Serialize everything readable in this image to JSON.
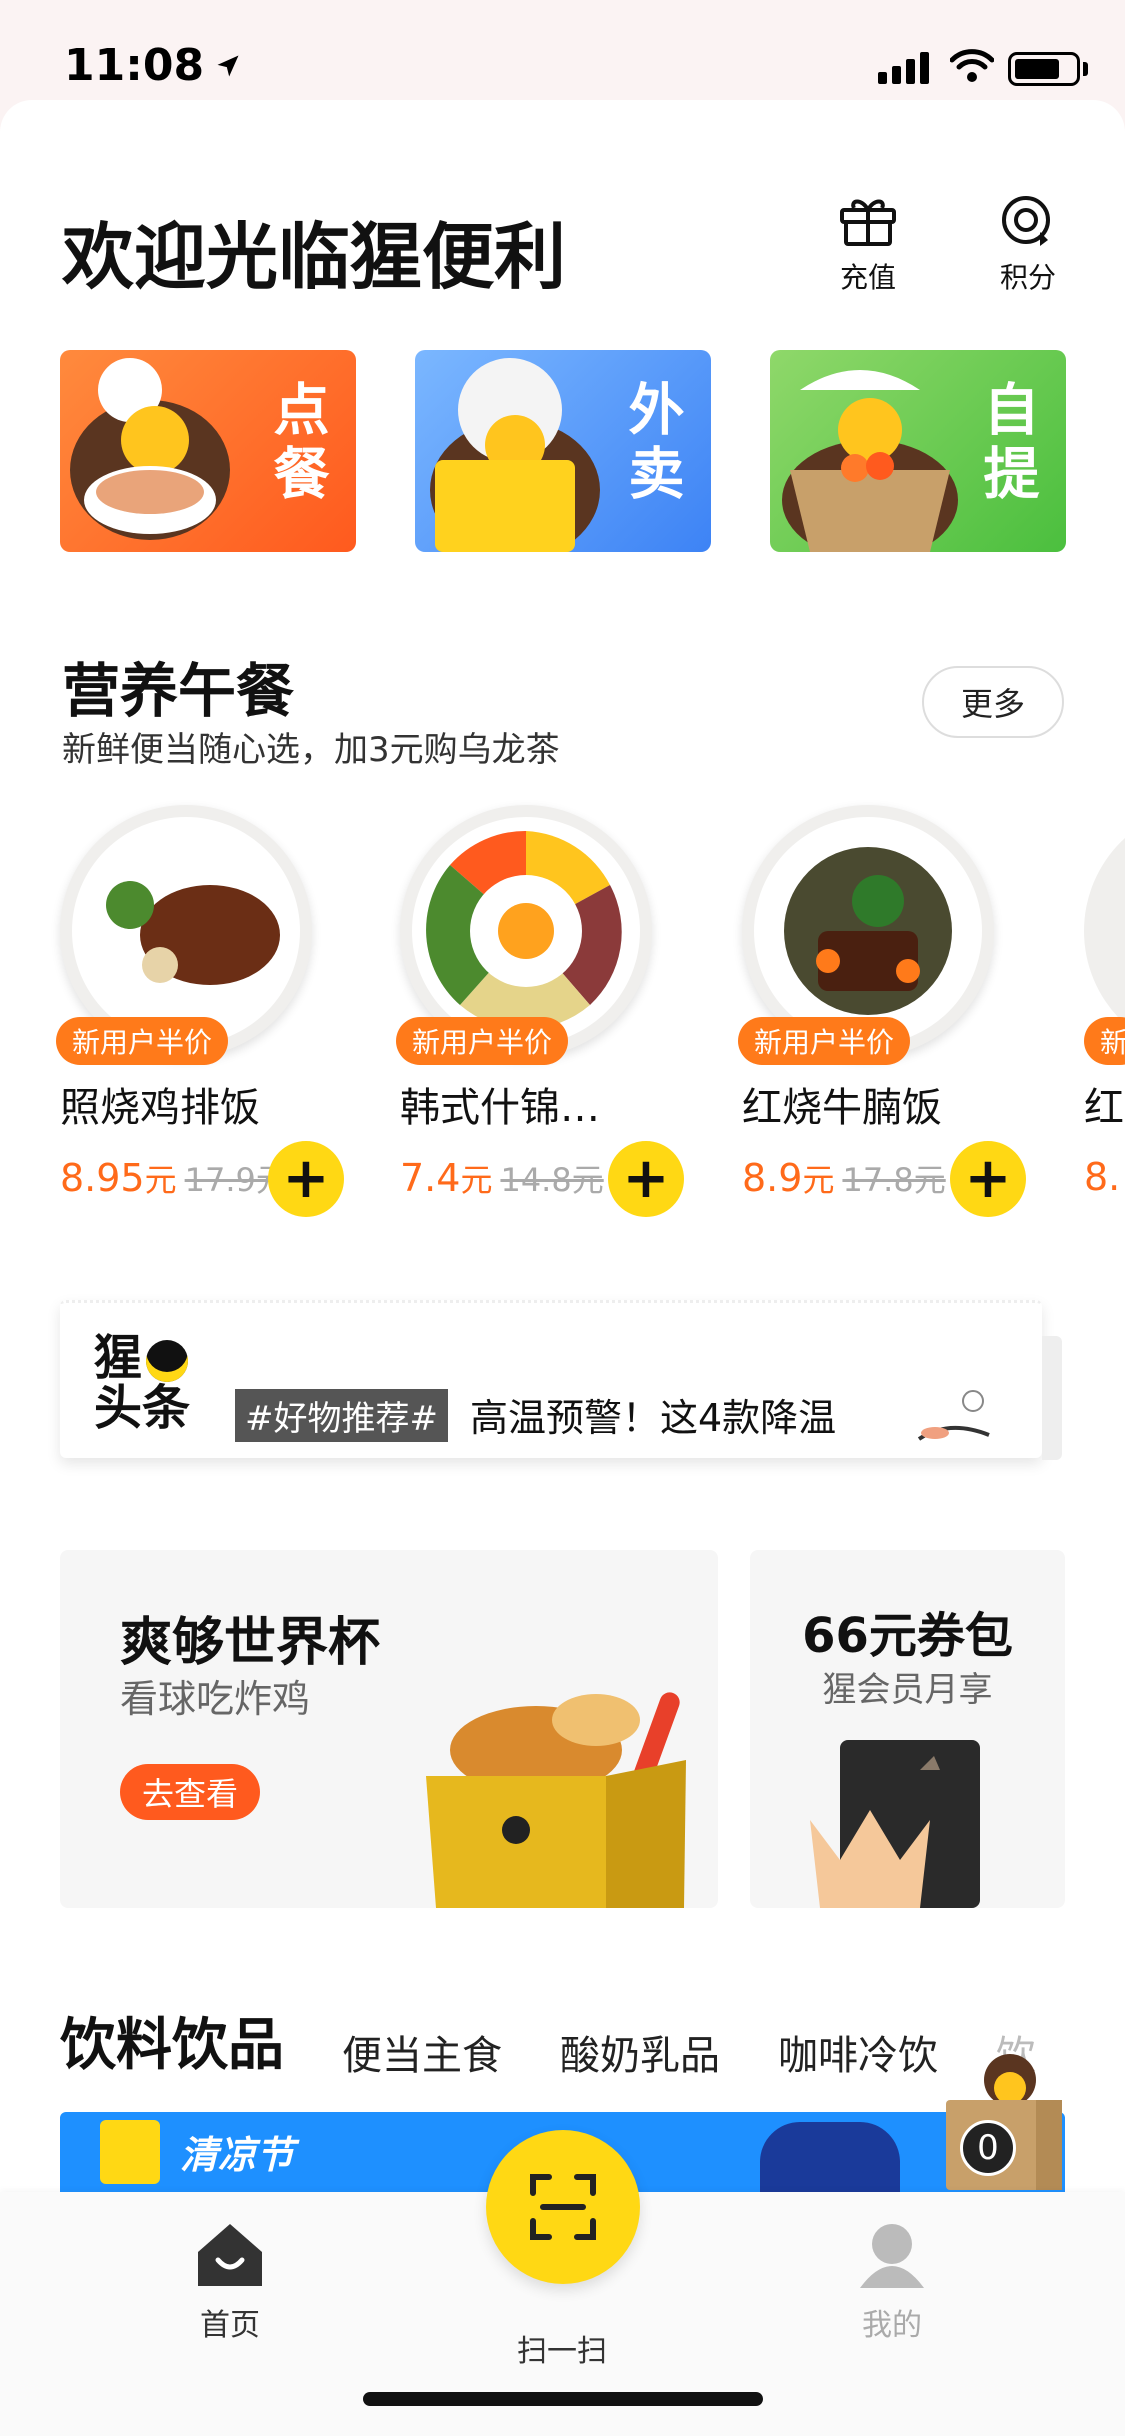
{
  "status_bar": {
    "time": "11:08"
  },
  "header": {
    "welcome": "欢迎光临猩便利",
    "actions": [
      {
        "label": "充值",
        "icon": "gift-icon"
      },
      {
        "label": "积分",
        "icon": "points-icon"
      }
    ]
  },
  "services": [
    {
      "label": "点餐",
      "color": "#ff6a1e"
    },
    {
      "label": "外卖",
      "color": "#4a8ef7"
    },
    {
      "label": "自提",
      "color": "#5bc447"
    }
  ],
  "lunch": {
    "title": "营养午餐",
    "subtitle": "新鲜便当随心选，加3元购乌龙茶",
    "more": "更多",
    "products": [
      {
        "tag": "新用户半价",
        "name": "照烧鸡排饭",
        "price": "8.95",
        "unit": "元",
        "old_price": "17.9元",
        "add": "+"
      },
      {
        "tag": "新用户半价",
        "name": "韩式什锦…",
        "price": "7.4",
        "unit": "元",
        "old_price": "14.8元",
        "add": "+"
      },
      {
        "tag": "新用户半价",
        "name": "红烧牛腩饭",
        "price": "8.9",
        "unit": "元",
        "old_price": "17.8元",
        "add": "+"
      },
      {
        "tag": "新",
        "name": "红",
        "price": "8.",
        "unit": "",
        "old_price": "",
        "add": ""
      }
    ]
  },
  "headline": {
    "logo_line1": "猩",
    "logo_line2": "头条",
    "tag": "#好物推荐#",
    "text": "高温预警！这4款降温"
  },
  "promo_left": {
    "title": "爽够世界杯",
    "subtitle": "看球吃炸鸡",
    "button": "去查看"
  },
  "promo_right": {
    "title": "66元券包",
    "subtitle": "猩会员月享"
  },
  "categories": [
    {
      "label": "饮料饮品",
      "active": true
    },
    {
      "label": "便当主食"
    },
    {
      "label": "酸奶乳品"
    },
    {
      "label": "咖啡冷饮"
    },
    {
      "label": "饮"
    }
  ],
  "strip": {
    "label": "清凉节"
  },
  "cart": {
    "count": "0"
  },
  "tabbar": {
    "home": "首页",
    "scan": "扫一扫",
    "me": "我的"
  },
  "colors": {
    "accent": "#ffd814",
    "price": "#ff6a1a"
  }
}
